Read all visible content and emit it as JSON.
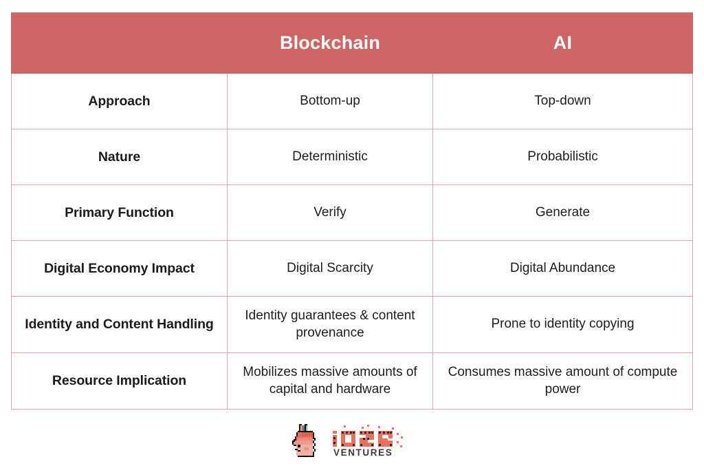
{
  "table": {
    "columns": [
      {
        "key": "label",
        "header": ""
      },
      {
        "key": "blockchain",
        "header": "Blockchain"
      },
      {
        "key": "ai",
        "header": "AI"
      }
    ],
    "rows": [
      {
        "label": "Approach",
        "blockchain": "Bottom-up",
        "ai": "Top-down"
      },
      {
        "label": "Nature",
        "blockchain": "Deterministic",
        "ai": "Probabilistic"
      },
      {
        "label": "Primary Function",
        "blockchain": "Verify",
        "ai": "Generate"
      },
      {
        "label": "Digital Economy Impact",
        "blockchain": "Digital Scarcity",
        "ai": "Digital Abundance"
      },
      {
        "label": "Identity and Content Handling",
        "blockchain": "Identity guarantees & content provenance",
        "ai": "Prone to identity copying"
      },
      {
        "label": "Resource Implication",
        "blockchain": "Mobilizes massive amounts of capital and hardware",
        "ai": "Consumes massive amount of compute power"
      }
    ]
  },
  "logo": {
    "mark": "llama-pixel-icon",
    "wordmark": "IOSG",
    "tagline": "VENTURES"
  },
  "colors": {
    "header_background": "#cd6565",
    "header_text": "#ffffff",
    "cell_border": "#e8a2a2",
    "body_text": "#1d1d1d",
    "page_background": "#ffffff",
    "logo_salmon": "#e8705f",
    "logo_dark": "#3a3a3a"
  }
}
